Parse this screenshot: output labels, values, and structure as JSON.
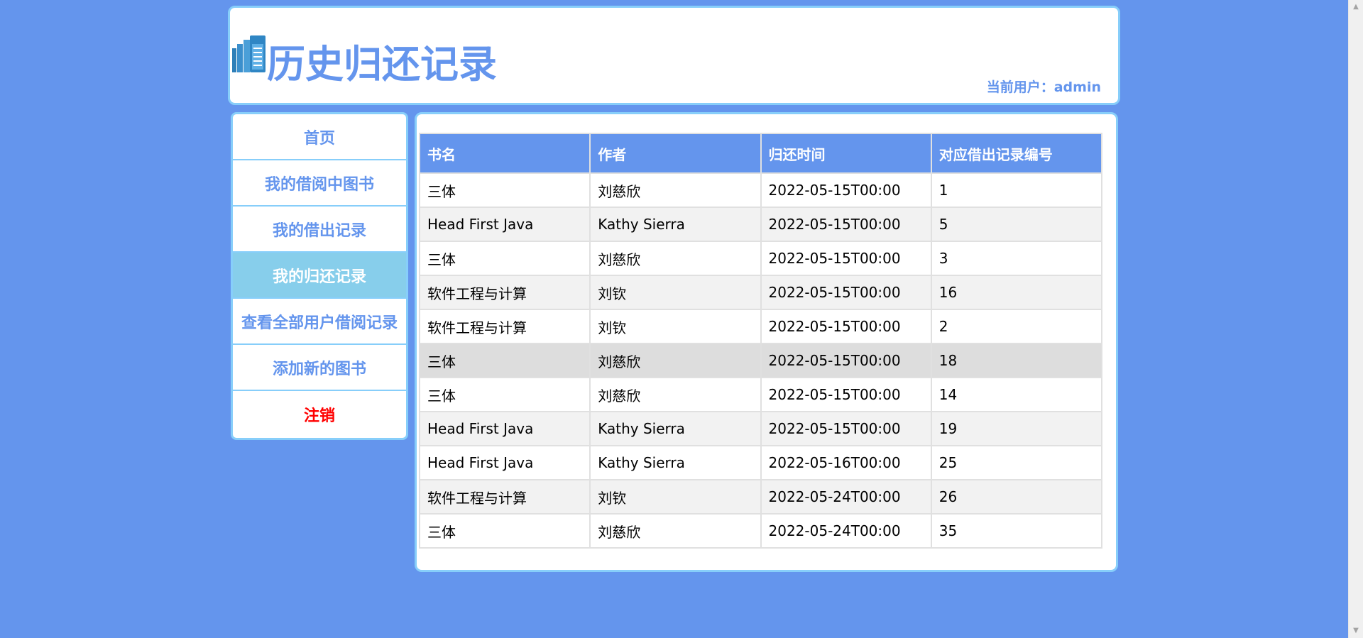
{
  "header": {
    "title": "历史归还记录",
    "user_label": "当前用户：admin"
  },
  "sidebar": {
    "items": [
      {
        "label": "首页"
      },
      {
        "label": "我的借阅中图书"
      },
      {
        "label": "我的借出记录"
      },
      {
        "label": "我的归还记录",
        "active": true
      },
      {
        "label": "查看全部用户借阅记录"
      },
      {
        "label": "添加新的图书"
      },
      {
        "label": "注销"
      }
    ]
  },
  "table": {
    "headers": [
      "书名",
      "作者",
      "归还时间",
      "对应借出记录编号"
    ],
    "rows": [
      [
        "三体",
        "刘慈欣",
        "2022-05-15T00:00",
        "1"
      ],
      [
        "Head First Java",
        "Kathy Sierra",
        "2022-05-15T00:00",
        "5"
      ],
      [
        "三体",
        "刘慈欣",
        "2022-05-15T00:00",
        "3"
      ],
      [
        "软件工程与计算",
        "刘钦",
        "2022-05-15T00:00",
        "16"
      ],
      [
        "软件工程与计算",
        "刘钦",
        "2022-05-15T00:00",
        "2"
      ],
      [
        "三体",
        "刘慈欣",
        "2022-05-15T00:00",
        "18"
      ],
      [
        "三体",
        "刘慈欣",
        "2022-05-15T00:00",
        "14"
      ],
      [
        "Head First Java",
        "Kathy Sierra",
        "2022-05-15T00:00",
        "19"
      ],
      [
        "Head First Java",
        "Kathy Sierra",
        "2022-05-16T00:00",
        "25"
      ],
      [
        "软件工程与计算",
        "刘钦",
        "2022-05-24T00:00",
        "26"
      ],
      [
        "三体",
        "刘慈欣",
        "2022-05-24T00:00",
        "35"
      ]
    ],
    "highlighted_row": 5
  },
  "colors": {
    "background": "#6495ED",
    "accent": "#6495ED",
    "border": "#87CEFA",
    "active_nav": "#87CEEB",
    "logout": "#FF0000"
  },
  "icons": {
    "logo": "books-logo-icon",
    "scroll_up": "scroll-up-arrow-icon",
    "scroll_down": "scroll-down-arrow-icon"
  }
}
